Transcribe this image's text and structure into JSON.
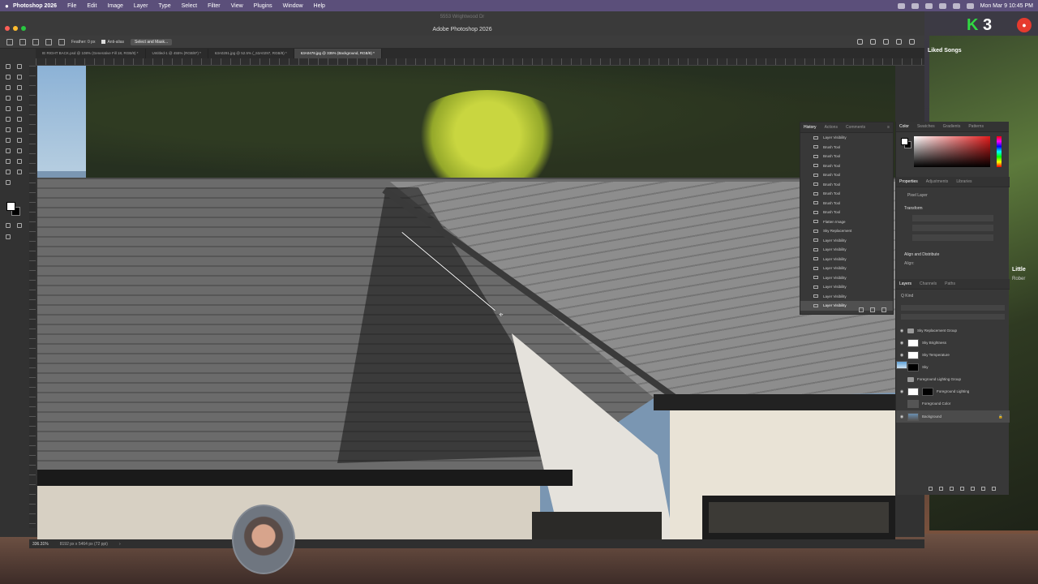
{
  "menubar": {
    "app_name": "Photoshop 2026",
    "items": [
      "File",
      "Edit",
      "Image",
      "Layer",
      "Type",
      "Select",
      "Filter",
      "View",
      "Plugins",
      "Window",
      "Help"
    ],
    "clock": "Mon Mar 9  10:45 PM"
  },
  "window": {
    "ghost_title": "5553 Wrightwood Dr",
    "title": "Adobe Photoshop 2026"
  },
  "options": {
    "feather_label": "Feather: 0 px",
    "anti_alias_label": "Anti-alias",
    "select_mask_label": "Select and Mask..."
  },
  "tabs": [
    {
      "label": "IE RIGHT BACK.psd @ 108% (Generative Fill 18, RGB/8) *",
      "active": false
    },
    {
      "label": "Untitled-1 @ 455% (RGB/8*) *",
      "active": false
    },
    {
      "label": "63A0291.jpg @ 52.5% (_63A0297, RGB/8) *",
      "active": false
    },
    {
      "label": "63A0478.jpg @ 335% (Background, RGB/8) *",
      "active": true
    }
  ],
  "status": {
    "zoom": "336.31%",
    "doc_size": "8192 px x 5464 px (72 ppi)"
  },
  "history": {
    "tabs": [
      "History",
      "Actions",
      "Comments"
    ],
    "items": [
      "Layer Visibility",
      "Brush Tool",
      "Brush Tool",
      "Brush Tool",
      "Brush Tool",
      "Brush Tool",
      "Brush Tool",
      "Brush Tool",
      "Brush Tool",
      "Flatten Image",
      "Sky Replacement",
      "Layer Visibility",
      "Layer Visibility",
      "Layer Visibility",
      "Layer Visibility",
      "Layer Visibility",
      "Layer Visibility",
      "Layer Visibility",
      "Layer Visibility"
    ]
  },
  "color_panel": {
    "tabs": [
      "Color",
      "Swatches",
      "Gradients",
      "Patterns"
    ]
  },
  "properties": {
    "tabs": [
      "Properties",
      "Adjustments",
      "Libraries"
    ],
    "pixel_layer": "Pixel Layer",
    "transform": "Transform",
    "align": "Align and Distribute",
    "align_sub": "Align:"
  },
  "layers": {
    "tabs": [
      "Layers",
      "Channels",
      "Paths"
    ],
    "kind": "Q Kind",
    "items": [
      {
        "name": "Sky Replacement Group",
        "type": "group"
      },
      {
        "name": "Sky Brightness",
        "type": "adj"
      },
      {
        "name": "Sky Temperature",
        "type": "adj"
      },
      {
        "name": "Sky",
        "type": "sky"
      },
      {
        "name": "Foreground Lighting Group",
        "type": "group"
      },
      {
        "name": "Foreground Lighting",
        "type": "adj"
      },
      {
        "name": "Foreground Color",
        "type": "fill"
      },
      {
        "name": "Background",
        "type": "photo"
      }
    ]
  },
  "sidebar": {
    "k_number": "3",
    "liked_songs": "Liked Songs",
    "artist_line1": "Little",
    "artist_line2": "Rober"
  }
}
